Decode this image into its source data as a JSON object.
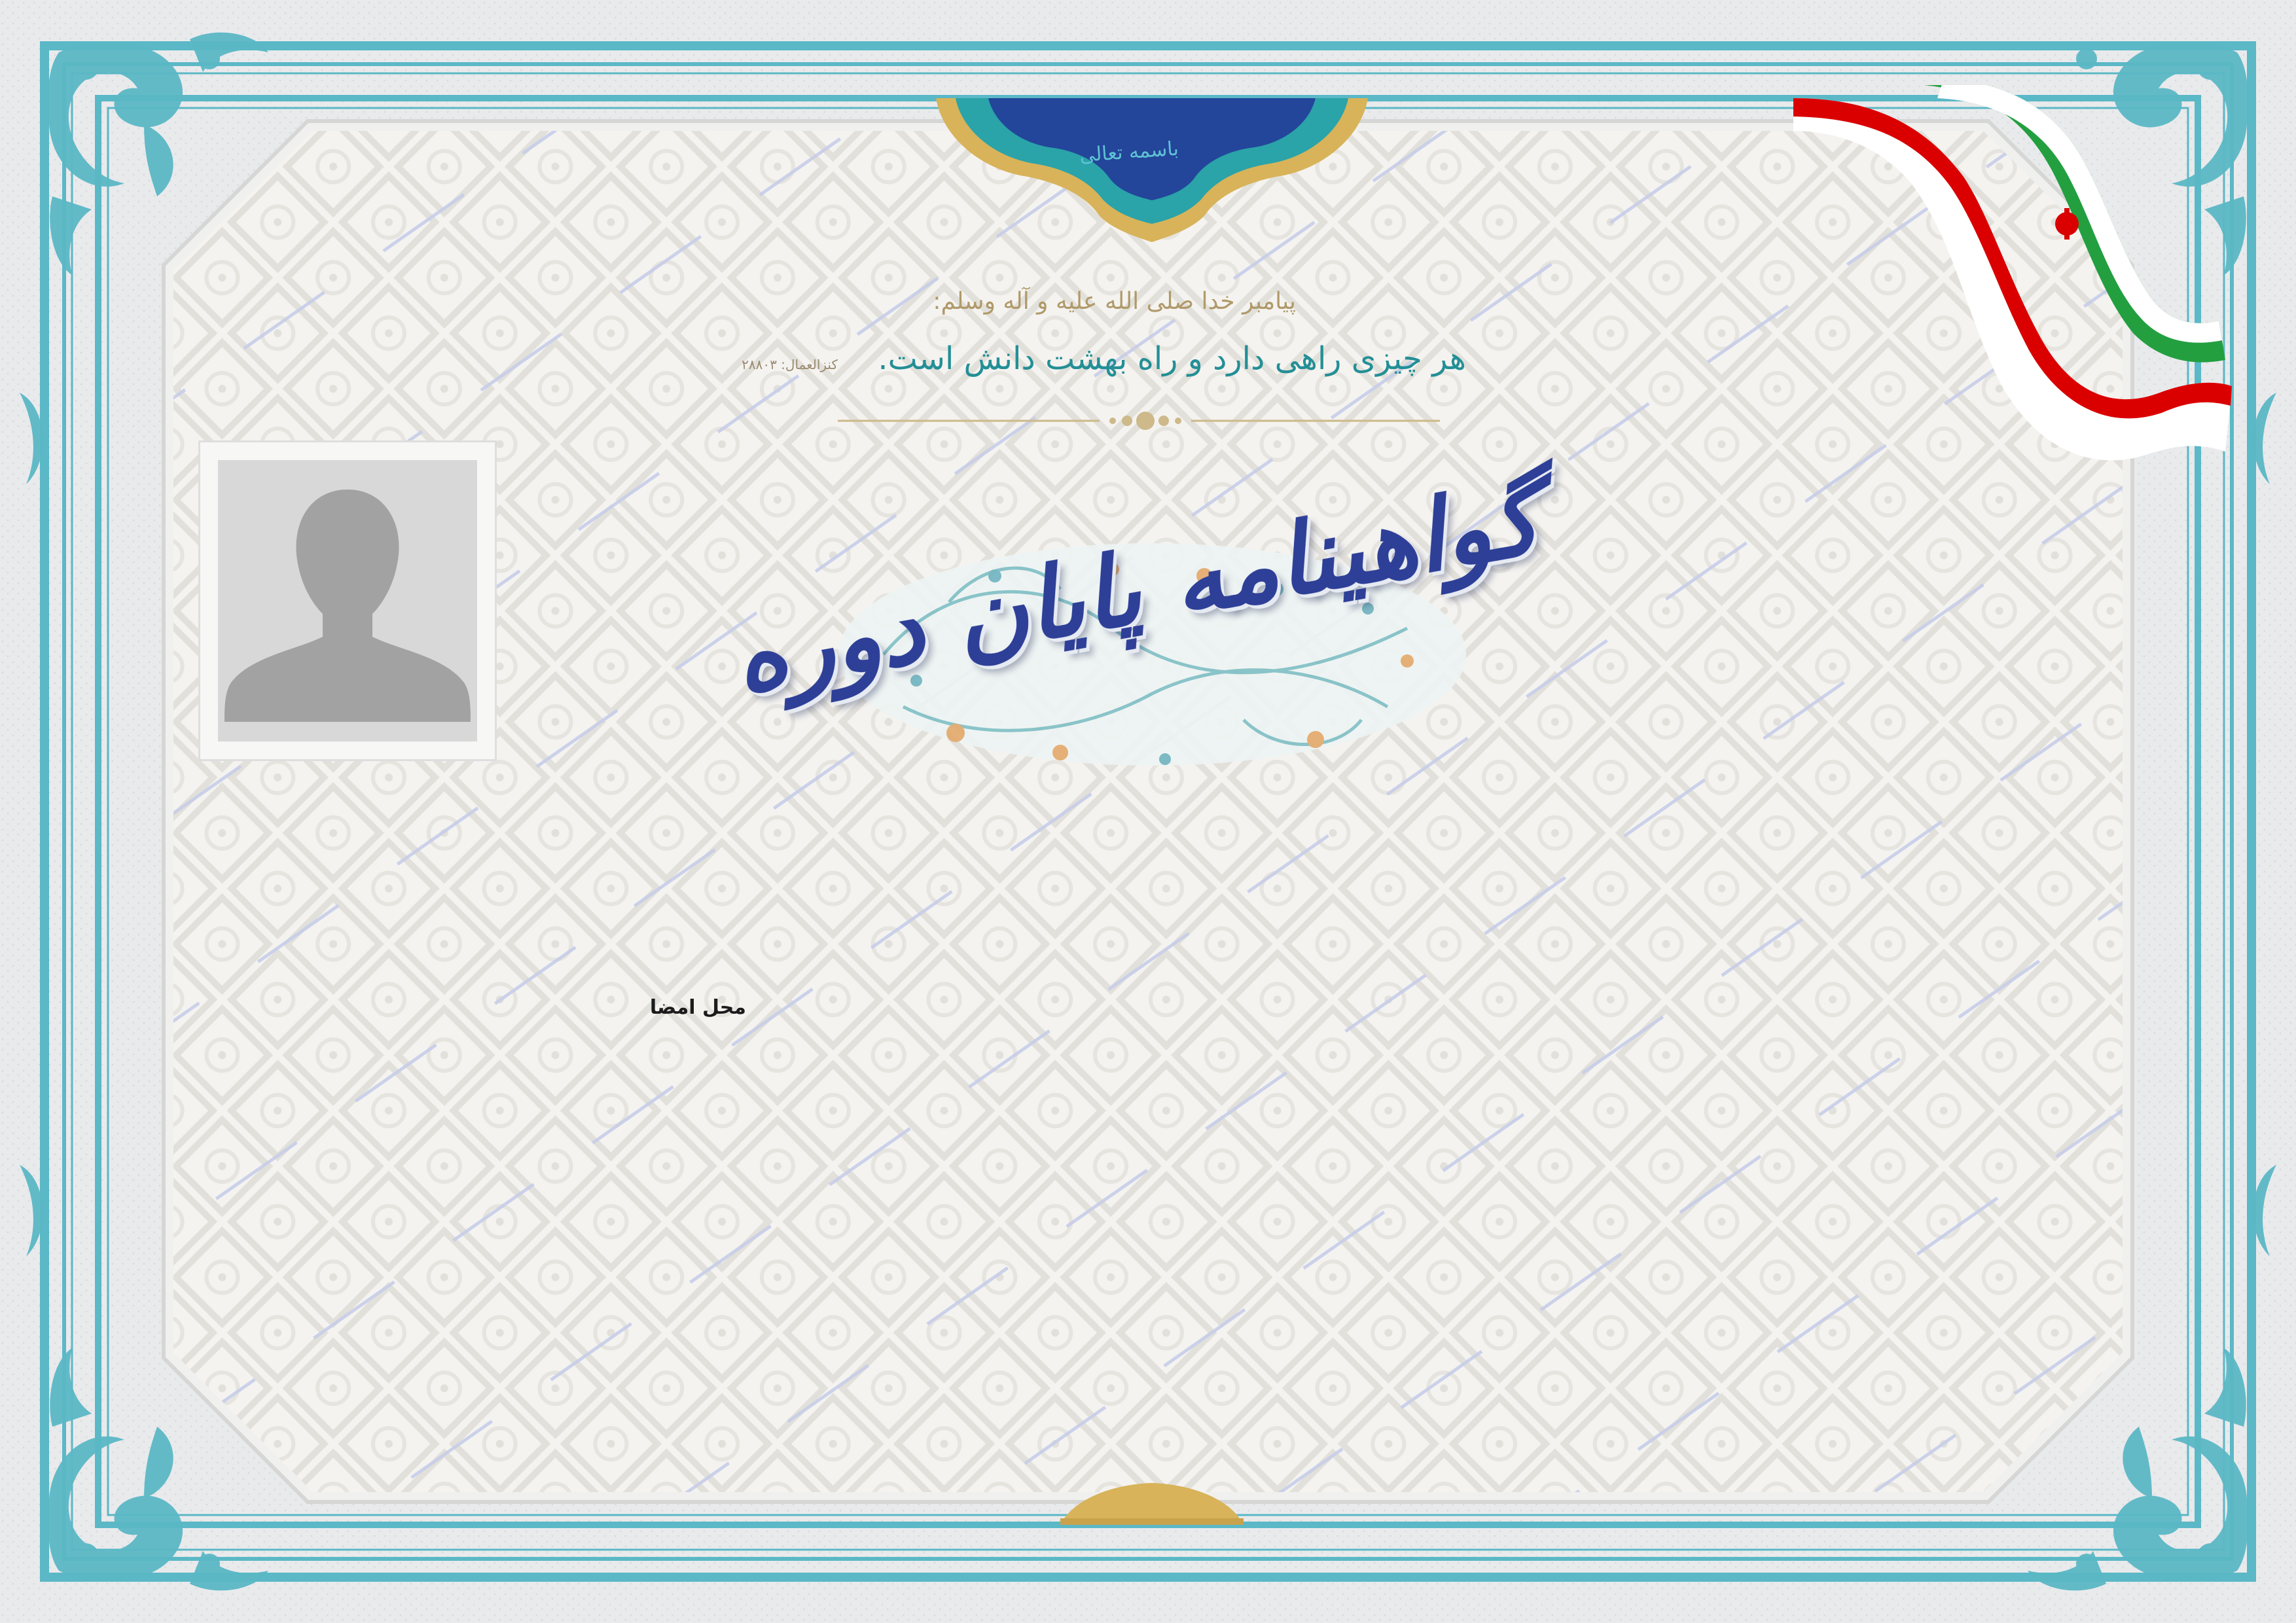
{
  "certificate": {
    "basmala": "باسمه تعالی",
    "prophet_line": "پیامبر خدا صلی الله علیه و آله وسلم:",
    "hadith_text": "هر چیزی راهی دارد و راه بهشت دانش است.",
    "hadith_source": "کنزالعمال: ۲۸۸۰۳",
    "title": "گواهینامه پایان دوره",
    "signature_label": "محل امضا"
  },
  "colors": {
    "frame_teal": "#5bb8c6",
    "title_blue": "#2d3f97",
    "hadith_teal": "#238f96",
    "gold": "#d8b35a",
    "flag_green": "#239f40",
    "flag_red": "#da0000"
  },
  "icons": [
    "person-silhouette-icon",
    "iran-flag-ribbon-icon",
    "lion-emblem-icon"
  ]
}
